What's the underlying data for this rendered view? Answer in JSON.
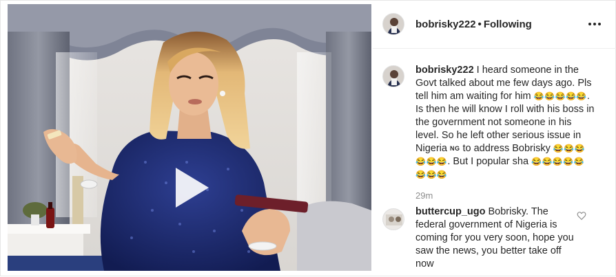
{
  "post": {
    "author": "bobrisky222",
    "follow_status": "Following",
    "separator": "•",
    "caption": {
      "username": "bobrisky222",
      "text_part1": "I heard someone in the Govt talked about me few days ago. Pls tell him am waiting for him",
      "emoji_run_1": "😂😂😂😂😂",
      "text_part2": ". Is then he will know I roll with his boss in the government not someone in his level. So he left other serious issue in Nigeria",
      "flag_text": "NG",
      "text_part3": "to address Bobrisky",
      "emoji_run_2": "😂😂😂😂😂😂",
      "text_part4": ". But I popular sha",
      "emoji_run_3": "😂😂😂😂😂😂😂😂"
    },
    "timestamp": "29m",
    "comment": {
      "username": "buttercup_ugo",
      "text": "Bobrisky. The federal government of Nigeria is coming for you very soon, hope you saw the news, you better take off now"
    }
  },
  "icons": {
    "more": "more-options-icon",
    "play": "play-icon",
    "like": "heart-icon"
  },
  "colors": {
    "text": "#262626",
    "secondary_text": "#8e8e8e",
    "border": "#efefef",
    "dress": "#1c2a6b",
    "hair": "#e0b470"
  }
}
